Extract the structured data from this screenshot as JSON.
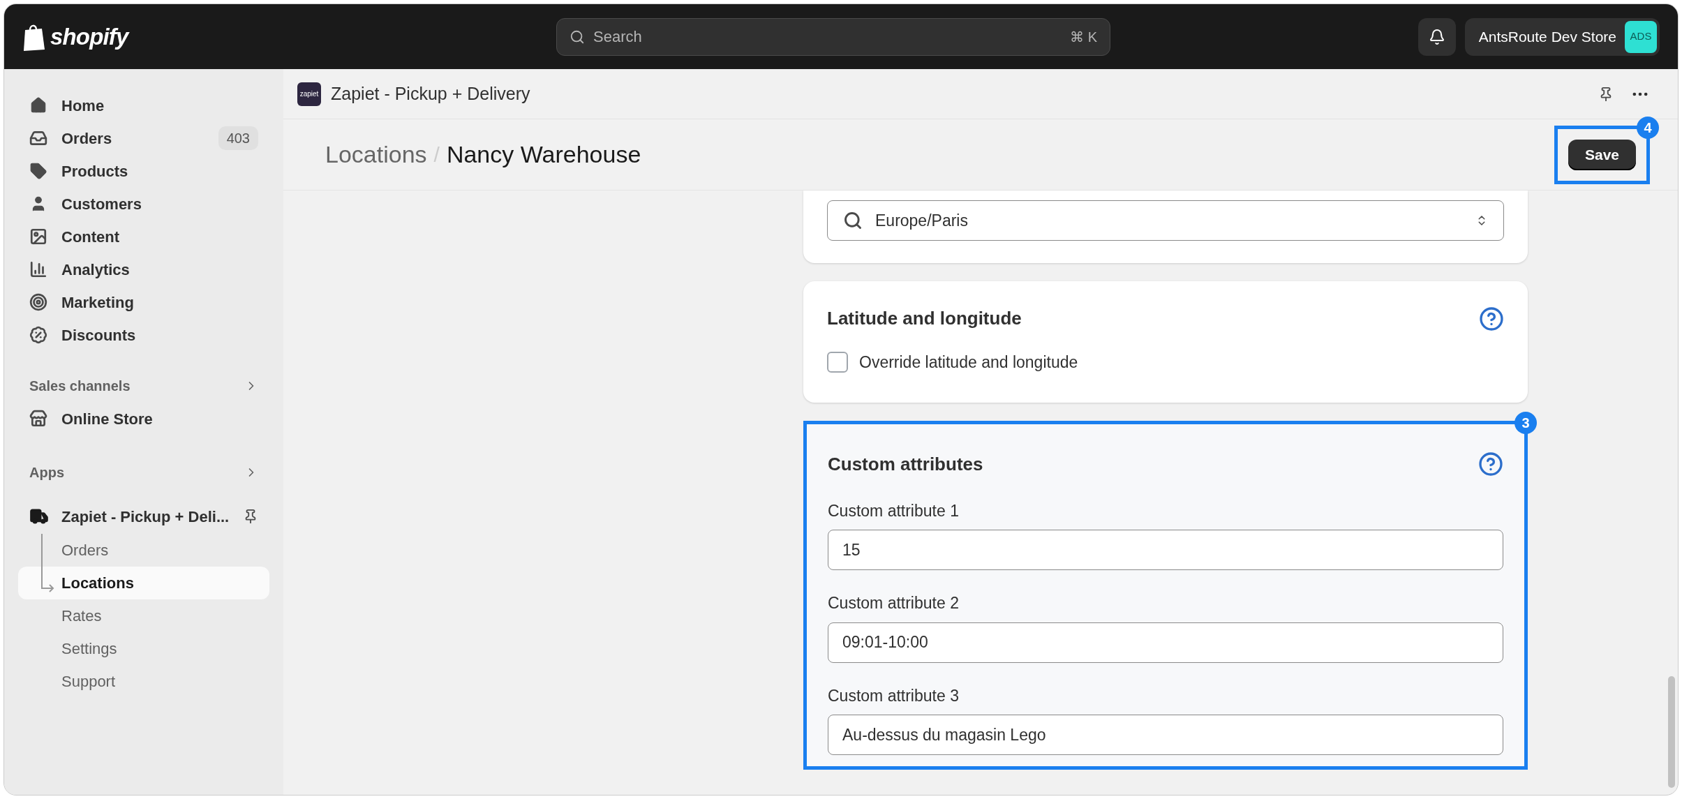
{
  "topbar": {
    "logo": "shopify",
    "search": {
      "placeholder": "Search",
      "shortcut": "⌘ K"
    },
    "store": {
      "name": "AntsRoute Dev Store",
      "initials": "ADS"
    }
  },
  "sidebar": {
    "items": [
      {
        "label": "Home",
        "kind": "home",
        "selected": false
      },
      {
        "label": "Orders",
        "kind": "inbox",
        "selected": false,
        "badge": "403"
      },
      {
        "label": "Products",
        "kind": "tag",
        "selected": false
      },
      {
        "label": "Customers",
        "kind": "person",
        "selected": false
      },
      {
        "label": "Content",
        "kind": "image",
        "selected": false
      },
      {
        "label": "Analytics",
        "kind": "chart",
        "selected": false
      },
      {
        "label": "Marketing",
        "kind": "target",
        "selected": false
      },
      {
        "label": "Discounts",
        "kind": "percent",
        "selected": false
      }
    ],
    "sales_channels": {
      "title": "Sales channels",
      "items": [
        {
          "label": "Online Store",
          "kind": "store",
          "selected": false
        }
      ]
    },
    "apps": {
      "title": "Apps",
      "app": {
        "label": "Zapiet - Pickup + Deli..."
      },
      "children": [
        {
          "label": "Orders",
          "selected": false
        },
        {
          "label": "Locations",
          "selected": true
        },
        {
          "label": "Rates",
          "selected": false
        },
        {
          "label": "Settings",
          "selected": false
        },
        {
          "label": "Support",
          "selected": false
        }
      ]
    }
  },
  "app_header": {
    "logo_text": "zapiet",
    "name": "Zapiet - Pickup + Delivery"
  },
  "page_header": {
    "breadcrumb": "Locations",
    "separator": "/",
    "title": "Nancy Warehouse",
    "save_button": "Save",
    "annotation": "4"
  },
  "timezone_card": {
    "value": "Europe/Paris"
  },
  "location_card": {
    "title": "Latitude and longitude",
    "checkbox": {
      "label": "Override latitude and longitude",
      "checked": false
    }
  },
  "attributes_card": {
    "title": "Custom attributes",
    "annotation": "3",
    "fields": [
      {
        "label": "Custom attribute 1",
        "value": "15"
      },
      {
        "label": "Custom attribute 2",
        "value": "09:01-10:00"
      },
      {
        "label": "Custom attribute 3",
        "value": "Au-dessus du magasin Lego"
      }
    ]
  }
}
